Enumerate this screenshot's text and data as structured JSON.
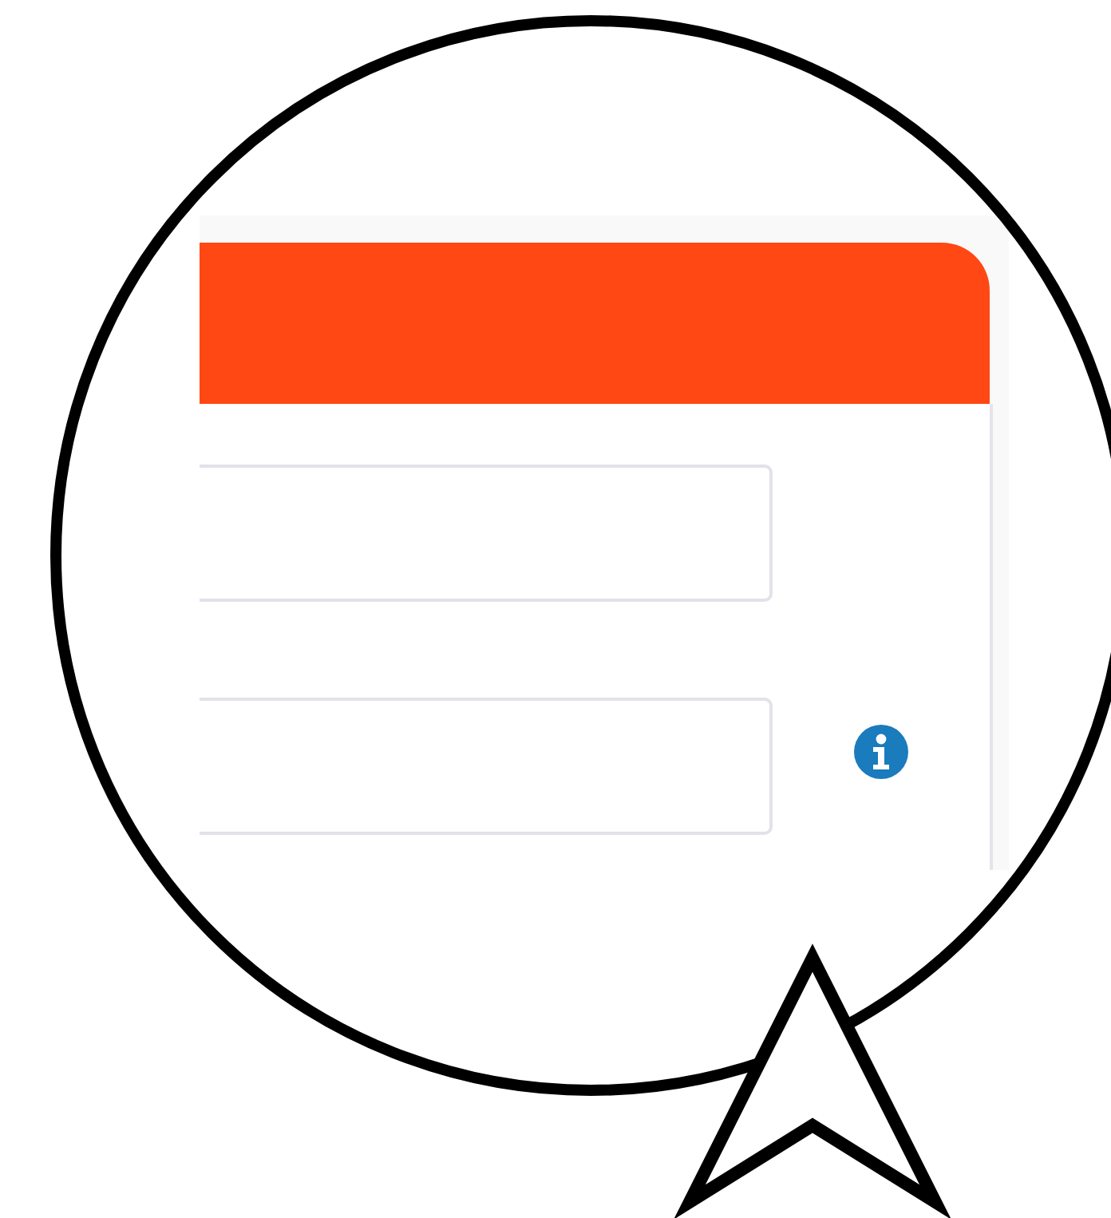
{
  "panel": {
    "fields": [
      {
        "has_info": false
      },
      {
        "has_info": true
      }
    ]
  }
}
